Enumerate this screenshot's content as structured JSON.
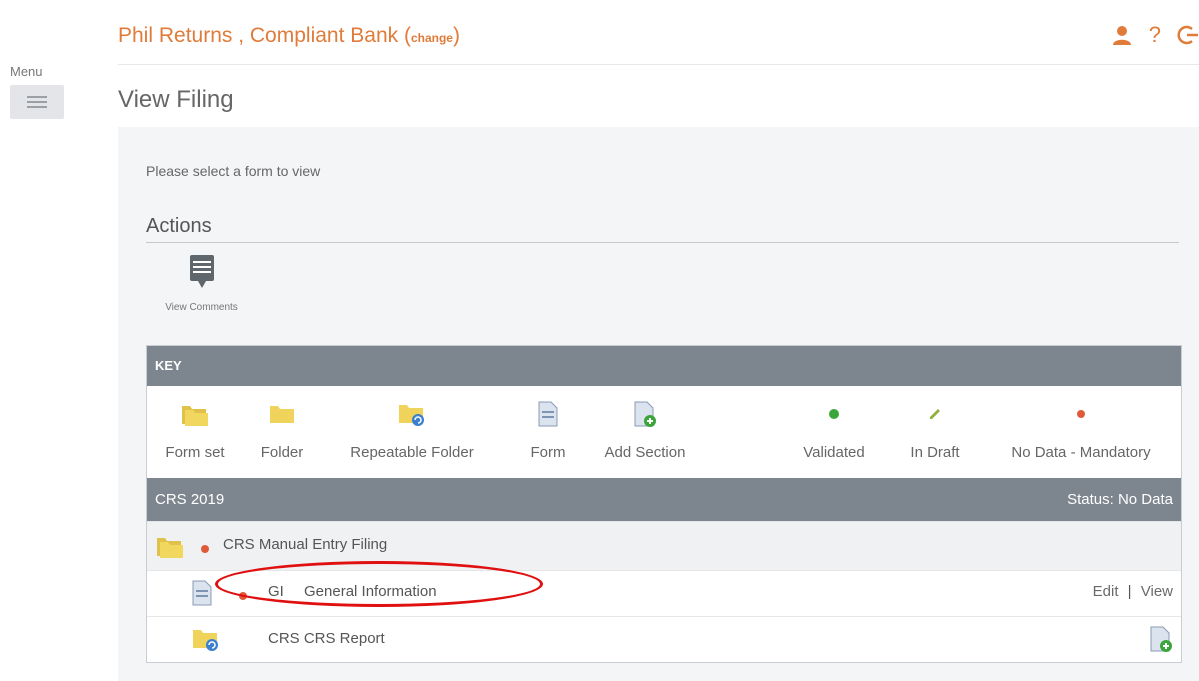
{
  "sidebar": {
    "menu_label": "Menu"
  },
  "header": {
    "org_name": "Phil Returns , Compliant Bank ",
    "change_open": "(",
    "change_label": "change",
    "change_close": ")"
  },
  "page": {
    "title": "View Filing",
    "prompt": "Please select a form to view"
  },
  "actions": {
    "title": "Actions",
    "view_comments_label": "View Comments"
  },
  "key": {
    "header": "KEY",
    "items": [
      {
        "label": "Form set"
      },
      {
        "label": "Folder"
      },
      {
        "label": "Repeatable Folder"
      },
      {
        "label": "Form"
      },
      {
        "label": "Add Section"
      },
      {
        "label": "Validated"
      },
      {
        "label": "In Draft"
      },
      {
        "label": "No Data - Mandatory"
      }
    ]
  },
  "filing": {
    "name": "CRS 2019",
    "status": "Status: No Data",
    "rows": [
      {
        "label": "CRS Manual Entry Filing"
      },
      {
        "code": "GI",
        "label": "General Information",
        "edit": "Edit",
        "sep": "|",
        "view": "View"
      },
      {
        "label": "CRS CRS Report"
      }
    ]
  },
  "colors": {
    "accent": "#e07b3a",
    "header_gray": "#7d868e",
    "validated": "#3aa53a",
    "draft": "#8fb03a",
    "mandatory": "#e05a3a",
    "highlight": "#e01010"
  }
}
